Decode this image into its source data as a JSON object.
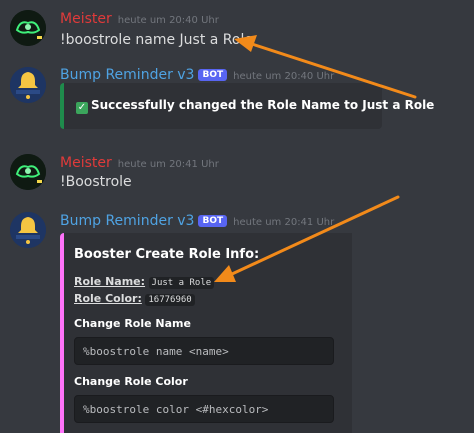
{
  "messages": [
    {
      "author": "Meister",
      "timestamp": "heute um 20:40 Uhr",
      "content": "!boostrole name Just a Role",
      "author_color": "#e03a3a"
    },
    {
      "author": "Bump Reminder v3",
      "bot_tag": "BOT",
      "timestamp": "heute um 20:40 Uhr",
      "embed_text": "Successfully changed the Role Name to Just a Role",
      "embed_color": "#1f8b4c",
      "author_color": "#4fa3e3"
    },
    {
      "author": "Meister",
      "timestamp": "heute um 20:41 Uhr",
      "content": "!Boostrole",
      "author_color": "#e03a3a"
    },
    {
      "author": "Bump Reminder v3",
      "bot_tag": "BOT",
      "timestamp": "heute um 20:41 Uhr",
      "embed_color": "#ff73fa",
      "embed": {
        "title": "Booster Create Role Info:",
        "role_name_label": "Role Name:",
        "role_name_value": "Just a Role",
        "role_color_label": "Role Color:",
        "role_color_value": "16776960",
        "field1_name": "Change Role Name",
        "field1_value": "%boostrole name <name>",
        "field2_name": "Change Role Color",
        "field2_value": "%boostrole color <#hexcolor>"
      }
    }
  ],
  "avatars": {
    "meister_icon": "neon-logo-avatar",
    "bot_icon": "bell-avatar"
  },
  "annotations": {
    "arrow_color": "#f28a1a"
  }
}
